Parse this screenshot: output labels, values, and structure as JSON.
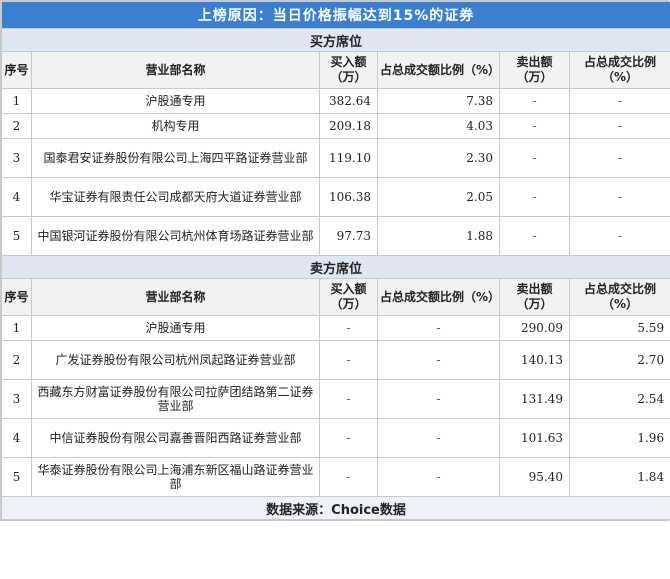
{
  "title": "上榜原因：当日价格振幅达到15%的证券",
  "headers": {
    "idx": "序号",
    "name": "营业部名称",
    "buy": "买入额（万）",
    "buy_pct": "占总成交额比例（%）",
    "sell": "卖出额（万）",
    "sell_pct": "占总成交比例（%）"
  },
  "buy_section": {
    "label": "买方席位",
    "rows": [
      {
        "idx": "1",
        "name": "沪股通专用",
        "buy": "382.64",
        "buy_pct": "7.38",
        "sell": "-",
        "sell_pct": "-"
      },
      {
        "idx": "2",
        "name": "机构专用",
        "buy": "209.18",
        "buy_pct": "4.03",
        "sell": "-",
        "sell_pct": "-"
      },
      {
        "idx": "3",
        "name": "国泰君安证券股份有限公司上海四平路证券营业部",
        "buy": "119.10",
        "buy_pct": "2.30",
        "sell": "-",
        "sell_pct": "-"
      },
      {
        "idx": "4",
        "name": "华宝证券有限责任公司成都天府大道证券营业部",
        "buy": "106.38",
        "buy_pct": "2.05",
        "sell": "-",
        "sell_pct": "-"
      },
      {
        "idx": "5",
        "name": "中国银河证券股份有限公司杭州体育场路证券营业部",
        "buy": "97.73",
        "buy_pct": "1.88",
        "sell": "-",
        "sell_pct": "-"
      }
    ]
  },
  "sell_section": {
    "label": "卖方席位",
    "rows": [
      {
        "idx": "1",
        "name": "沪股通专用",
        "buy": "-",
        "buy_pct": "-",
        "sell": "290.09",
        "sell_pct": "5.59"
      },
      {
        "idx": "2",
        "name": "广发证券股份有限公司杭州凤起路证券营业部",
        "buy": "-",
        "buy_pct": "-",
        "sell": "140.13",
        "sell_pct": "2.70"
      },
      {
        "idx": "3",
        "name": "西藏东方财富证券股份有限公司拉萨团结路第二证券营业部",
        "buy": "-",
        "buy_pct": "-",
        "sell": "131.49",
        "sell_pct": "2.54"
      },
      {
        "idx": "4",
        "name": "中信证券股份有限公司嘉善晋阳西路证券营业部",
        "buy": "-",
        "buy_pct": "-",
        "sell": "101.63",
        "sell_pct": "1.96"
      },
      {
        "idx": "5",
        "name": "华泰证券股份有限公司上海浦东新区福山路证券营业部",
        "buy": "-",
        "buy_pct": "-",
        "sell": "95.40",
        "sell_pct": "1.84"
      }
    ]
  },
  "footer": "数据来源：Choice数据",
  "colors": {
    "title_bg": "#3a7fd0",
    "section_bg": "#dfe7f3"
  }
}
